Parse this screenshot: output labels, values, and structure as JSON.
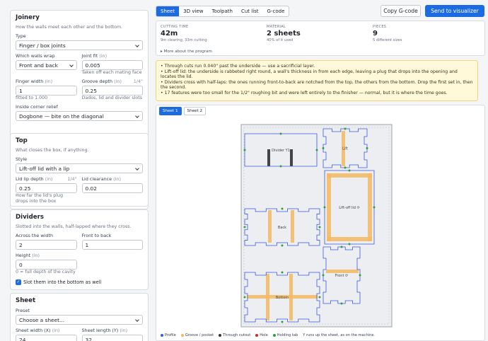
{
  "sidebar": {
    "joinery": {
      "title": "Joinery",
      "note": "How the walls meet each other and the bottom.",
      "type_label": "Type",
      "type_value": "Finger / box joints",
      "wrap_label": "Which walls wrap",
      "wrap_value": "Front and back",
      "fit_label": "Joint fit",
      "fit_unit": "(in)",
      "fit_value": "0.005",
      "fit_note": "Taken off each mating face",
      "finger_label": "Finger width",
      "finger_unit": "(in)",
      "finger_value": "1",
      "finger_note": "fitted to 1.000",
      "groove_label": "Groove depth",
      "groove_unit": "(in)",
      "groove_frac": "1/4\"",
      "groove_value": "0.25",
      "groove_note": "Dados, lid and divider slots",
      "relief_label": "Inside corner relief",
      "relief_value": "Dogbone — bite on the diagonal"
    },
    "top": {
      "title": "Top",
      "note": "What closes the box, if anything.",
      "style_label": "Style",
      "style_value": "Lift-off lid with a lip",
      "lipdepth_label": "Lid lip depth",
      "lipdepth_unit": "(in)",
      "lipdepth_frac": "1/4\"",
      "lipdepth_value": "0.25",
      "lipclear_label": "Lid clearance",
      "lipclear_unit": "(in)",
      "lipclear_value": "0.02",
      "lip_note": "How far the lid's plug drops into the box"
    },
    "dividers": {
      "title": "Dividers",
      "note": "Slotted into the walls, half-lapped where they cross.",
      "across_label": "Across the width",
      "across_value": "2",
      "ftb_label": "Front to back",
      "ftb_value": "1",
      "height_label": "Height",
      "height_unit": "(in)",
      "height_value": "0",
      "height_note": "0 = full depth of the cavity",
      "slot_label": "Slot them into the bottom as well"
    },
    "sheet": {
      "title": "Sheet",
      "preset_label": "Preset",
      "preset_value": "Choose a sheet...",
      "width_label": "Sheet width (X)",
      "width_unit": "(in)",
      "width_value": "24",
      "length_label": "Sheet length (Y)",
      "length_unit": "(in)",
      "length_value": "32"
    }
  },
  "toolbar": {
    "tabs": [
      "Sheet",
      "3D view",
      "Toolpath",
      "Cut list",
      "G-code"
    ],
    "copy": "Copy G-code",
    "send": "Send to visualizer"
  },
  "stats": {
    "cut_k": "CUTTING TIME",
    "cut_v": "42m",
    "cut_s": "9m clearing, 33m cutting",
    "mat_k": "MATERIAL",
    "mat_v": "2 sheets",
    "mat_s": "40% of it used",
    "pcs_k": "PIECES",
    "pcs_v": "9",
    "pcs_s": "5 different sizes",
    "more": "▸ More about the program"
  },
  "alert": [
    "• Through cuts run 0.040\" past the underside — use a sacrificial layer.",
    "• Lift-off lid: the underside is rabbeted right round, a wall's thickness in from each edge, leaving a plug that drops into the opening and locates the lid.",
    "• Dividers cross with half-laps: the ones running front-to-back are notched from the top, the others from the bottom. Drop the first set in, then the second.",
    "• 17 features were too small for the 1/2\" roughing bit and were left entirely to the finisher — normal, but it is where the time goes."
  ],
  "sheet_tabs": [
    "Sheet 1",
    "Sheet 2"
  ],
  "parts": {
    "divider": "Divider Y1",
    "lift": "Lift",
    "liftoff": "Lift-off lid ⟳",
    "back": "Back",
    "front": "Front ⟳",
    "bottom": "Bottom"
  },
  "legend": {
    "profile": "Profile",
    "groove": "Groove / pocket",
    "through": "Through cutout",
    "hole": "Hole",
    "tab": "Holding tab",
    "note": "Y runs up the sheet, as on the machine."
  },
  "colors": {
    "accent": "#1d6be0",
    "profile": "#3b5bdb",
    "groove": "#f4b860",
    "tab": "#2f9e44",
    "hole": "#c92a2a",
    "alert_bg": "#fff8d9"
  }
}
